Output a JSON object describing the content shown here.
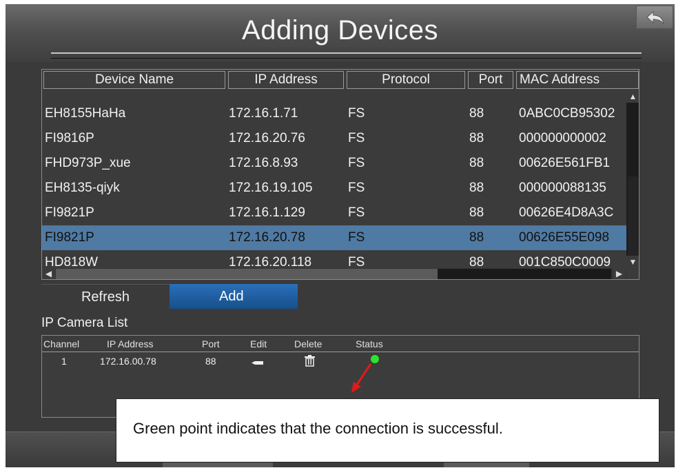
{
  "header": {
    "title": "Adding Devices",
    "back_icon": "back-arrow-icon"
  },
  "device_table": {
    "columns": [
      "Device Name",
      "IP Address",
      "Protocol",
      "Port",
      "MAC Address"
    ],
    "rows": [
      {
        "name": "EH8155HaHa",
        "ip": "172.16.1.71",
        "protocol": "FS",
        "port": "88",
        "mac": "0ABC0CB95302"
      },
      {
        "name": "FI9816P",
        "ip": "172.16.20.76",
        "protocol": "FS",
        "port": "88",
        "mac": "000000000002"
      },
      {
        "name": "FHD973P_xue",
        "ip": "172.16.8.93",
        "protocol": "FS",
        "port": "88",
        "mac": "00626E561FB1"
      },
      {
        "name": "EH8135-qiyk",
        "ip": "172.16.19.105",
        "protocol": "FS",
        "port": "88",
        "mac": "000000088135"
      },
      {
        "name": "FI9821P",
        "ip": "172.16.1.129",
        "protocol": "FS",
        "port": "88",
        "mac": "00626E4D8A3C"
      },
      {
        "name": "FI9821P",
        "ip": "172.16.20.78",
        "protocol": "FS",
        "port": "88",
        "mac": "00626E55E098"
      },
      {
        "name": "HD818W",
        "ip": "172.16.20.118",
        "protocol": "FS",
        "port": "88",
        "mac": "001C850C0009"
      }
    ],
    "selected_index": 5
  },
  "buttons": {
    "refresh": "Refresh",
    "add": "Add"
  },
  "ip_camera_list": {
    "label": "IP Camera List",
    "columns": [
      "Channel",
      "IP Address",
      "Port",
      "Edit",
      "Delete",
      "Status"
    ],
    "rows": [
      {
        "channel": "1",
        "ip": "172.16.00.78",
        "port": "88",
        "edit_icon": "edit-icon",
        "delete_icon": "trash-icon",
        "status_color": "#2ee32e"
      }
    ]
  },
  "callout": {
    "text": "Green point indicates that the connection is successful."
  },
  "colors": {
    "accent_blue": "#1f5fa3",
    "selected_row": "#4f7aa3",
    "status_green": "#2ee32e",
    "pointer_red": "#e21a1a"
  }
}
